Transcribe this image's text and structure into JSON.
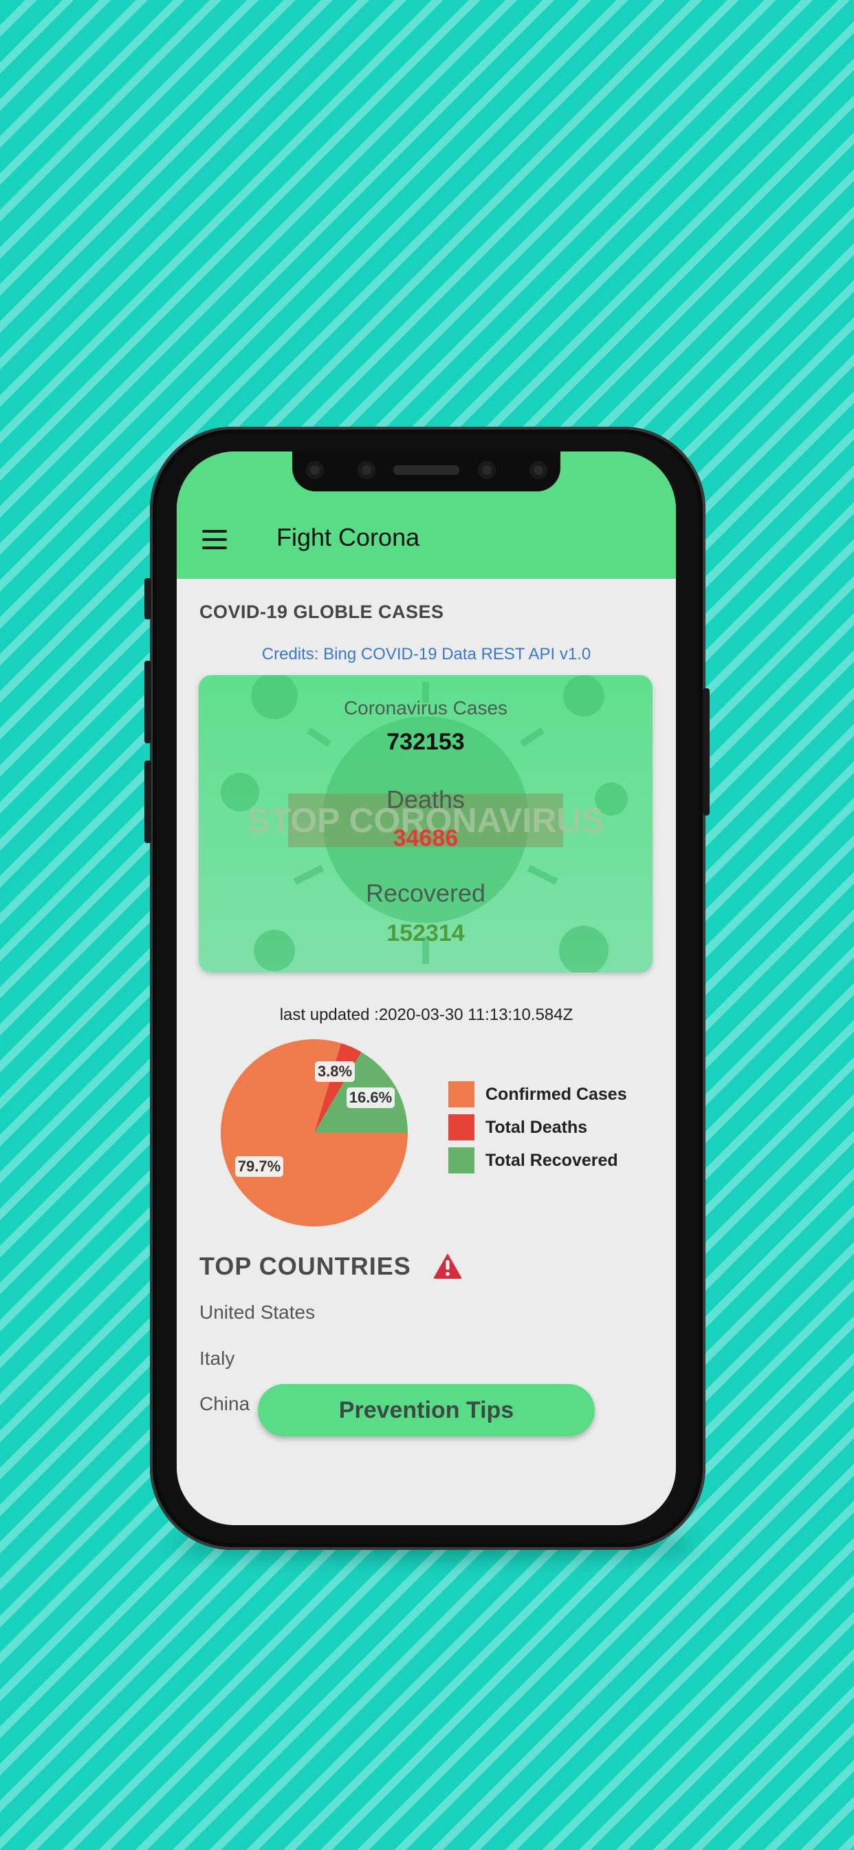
{
  "app": {
    "title": "Fight Corona",
    "menu_icon": "hamburger-menu-icon"
  },
  "header": {
    "section_title": "COVID-19 GLOBLE CASES",
    "credits": "Credits: Bing COVID-19 Data REST API v1.0"
  },
  "stats": {
    "cases_label": "Coronavirus Cases",
    "cases_value": "732153",
    "deaths_label": "Deaths",
    "deaths_value": "34686",
    "recovered_label": "Recovered",
    "recovered_value": "152314",
    "background_banner": "STOP CORONAVIRUS",
    "colors": {
      "deaths": "#e53935",
      "recovered": "#4f9d3a",
      "cases": "#111111"
    }
  },
  "last_updated": "last updated :2020-03-30 11:13:10.584Z",
  "chart_data": {
    "type": "pie",
    "categories": [
      "Confirmed Cases",
      "Total Deaths",
      "Total Recovered"
    ],
    "values": [
      79.7,
      3.8,
      16.6
    ],
    "labels": [
      "79.7%",
      "3.8%",
      "16.6%"
    ],
    "colors": [
      "#ef7a4c",
      "#e64336",
      "#67b26b"
    ],
    "legend_position": "right"
  },
  "top_countries": {
    "title": "TOP COUNTRIES",
    "warning_icon": "warning-triangle-icon",
    "items": [
      "United States",
      "Italy",
      "China"
    ]
  },
  "prevention_button": {
    "label": "Prevention Tips"
  }
}
